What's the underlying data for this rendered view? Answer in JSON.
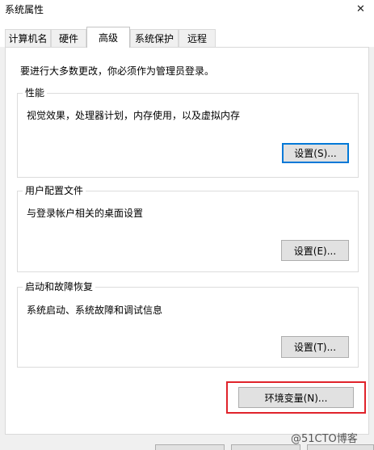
{
  "window": {
    "title": "系统属性",
    "close_glyph": "✕"
  },
  "tabs": [
    {
      "label": "计算机名",
      "active": false
    },
    {
      "label": "硬件",
      "active": false
    },
    {
      "label": "高级",
      "active": true
    },
    {
      "label": "系统保护",
      "active": false
    },
    {
      "label": "远程",
      "active": false
    }
  ],
  "advanced": {
    "admin_note": "要进行大多数更改，你必须作为管理员登录。",
    "performance": {
      "title": "性能",
      "description": "视觉效果，处理器计划，内存使用，以及虚拟内存",
      "button": "设置(S)..."
    },
    "user_profiles": {
      "title": "用户配置文件",
      "description": "与登录帐户相关的桌面设置",
      "button": "设置(E)..."
    },
    "startup_recovery": {
      "title": "启动和故障恢复",
      "description": "系统启动、系统故障和调试信息",
      "button": "设置(T)..."
    },
    "env_button": "环境变量(N)..."
  },
  "highlight_color": "#e0232b",
  "watermark": "@51CTO博客"
}
